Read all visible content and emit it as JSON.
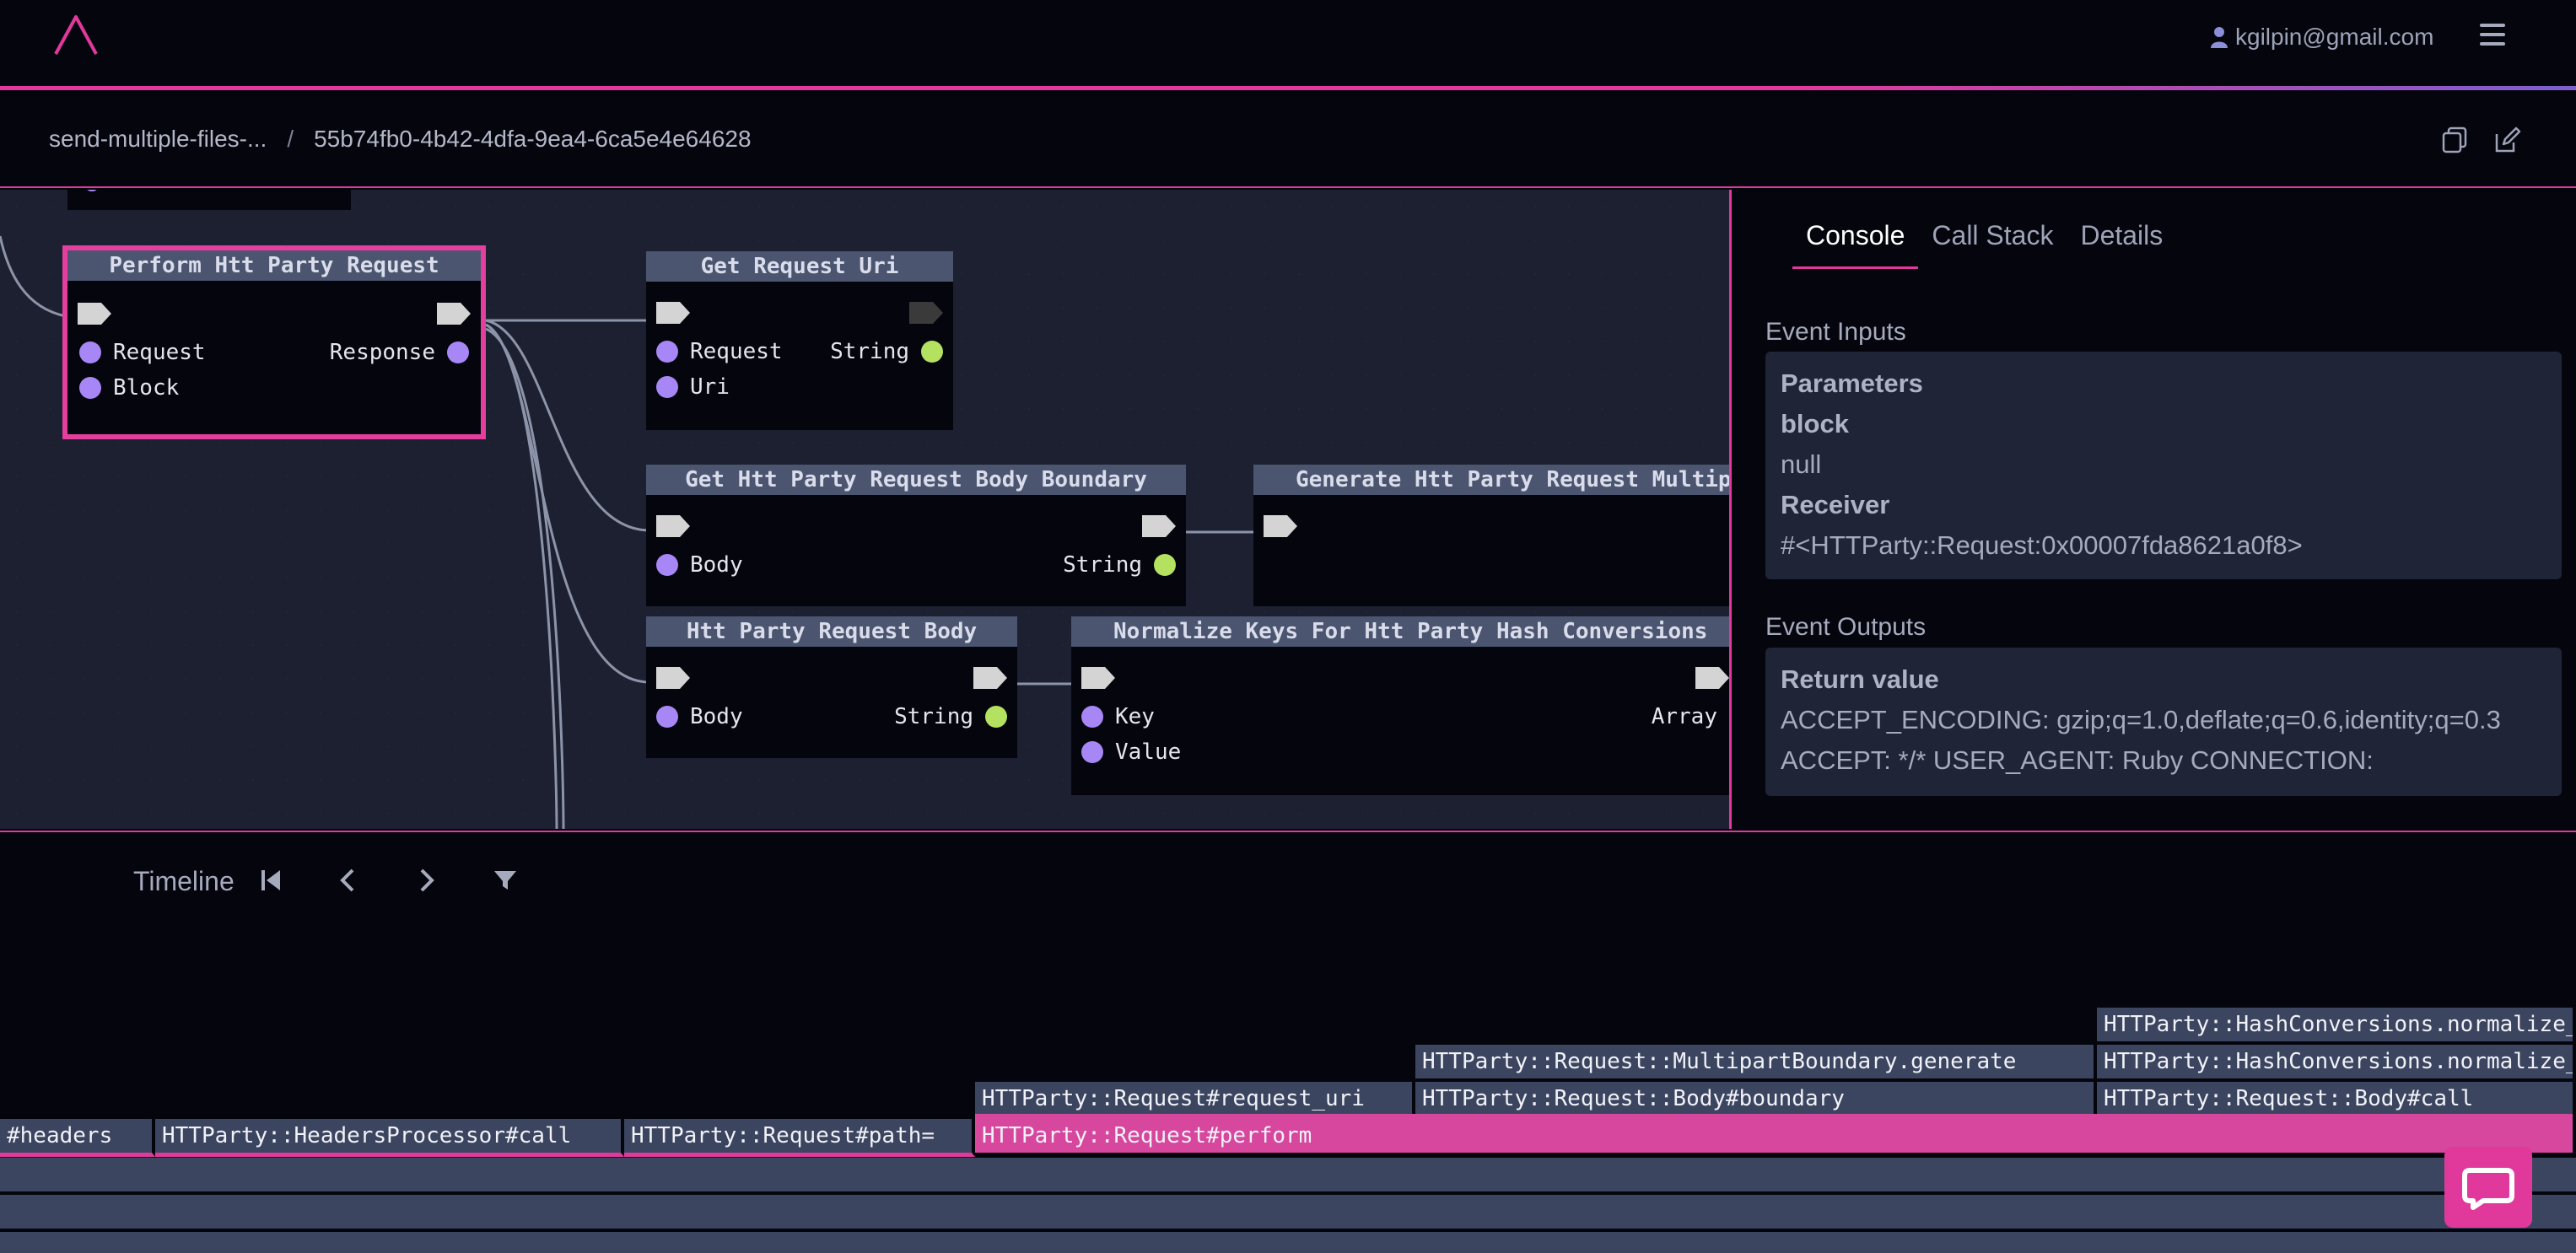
{
  "header": {
    "user_email": "kgilpin@gmail.com"
  },
  "breadcrumb": {
    "map_name": "send-multiple-files-...",
    "separator": "/",
    "event_id": "55b74fb0-4b42-4dfa-9ea4-6ca5e4e64628"
  },
  "graph": {
    "nodes": {
      "perform": {
        "title": "Perform Htt Party Request",
        "in1": "Request",
        "in2": "Block",
        "out1": "Response"
      },
      "get_uri": {
        "title": "Get Request Uri",
        "in1": "Request",
        "in2": "Uri",
        "out1": "String"
      },
      "boundary": {
        "title": "Get Htt Party Request Body Boundary",
        "in1": "Body",
        "out1": "String"
      },
      "generate": {
        "title": "Generate Htt Party Request Multipa"
      },
      "body": {
        "title": "Htt Party Request Body",
        "in1": "Body",
        "out1": "String"
      },
      "normalize": {
        "title": "Normalize Keys For Htt Party Hash Conversions",
        "in1": "Key",
        "in2": "Value",
        "out1": "Array"
      }
    }
  },
  "panel": {
    "tabs": [
      "Console",
      "Call Stack",
      "Details"
    ],
    "active_tab": "Console",
    "inputs_title": "Event Inputs",
    "inputs": {
      "parameters_label": "Parameters",
      "block_label": "block",
      "block_value": "null",
      "receiver_label": "Receiver",
      "receiver_value": "#<HTTParty::Request:0x00007fda8621a0f8>"
    },
    "outputs_title": "Event Outputs",
    "outputs": {
      "return_label": "Return value",
      "return_line1": "ACCEPT_ENCODING: gzip;q=1.0,deflate;q=0.6,identity;q=0.3",
      "return_line2": "ACCEPT: */* USER_AGENT: Ruby CONNECTION:"
    }
  },
  "timeline": {
    "label": "Timeline",
    "frames": {
      "headers": "#headers",
      "headers_processor": "HTTParty::HeadersProcessor#call",
      "path": "HTTParty::Request#path=",
      "perform": "HTTParty::Request#perform",
      "request_uri": "HTTParty::Request#request_uri",
      "multipart": "HTTParty::Request::MultipartBoundary.generate",
      "boundary": "HTTParty::Request::Body#boundary",
      "normalize_1": "HTTParty::HashConversions.normalize_",
      "normalize_2": "HTTParty::HashConversions.normalize_",
      "body_call": "HTTParty::Request::Body#call"
    }
  },
  "colors": {
    "accent": "#e0399b",
    "node_header": "#4b5570",
    "port_purple": "#a786f5",
    "port_green": "#b4e160",
    "frame": "#3c4560"
  }
}
